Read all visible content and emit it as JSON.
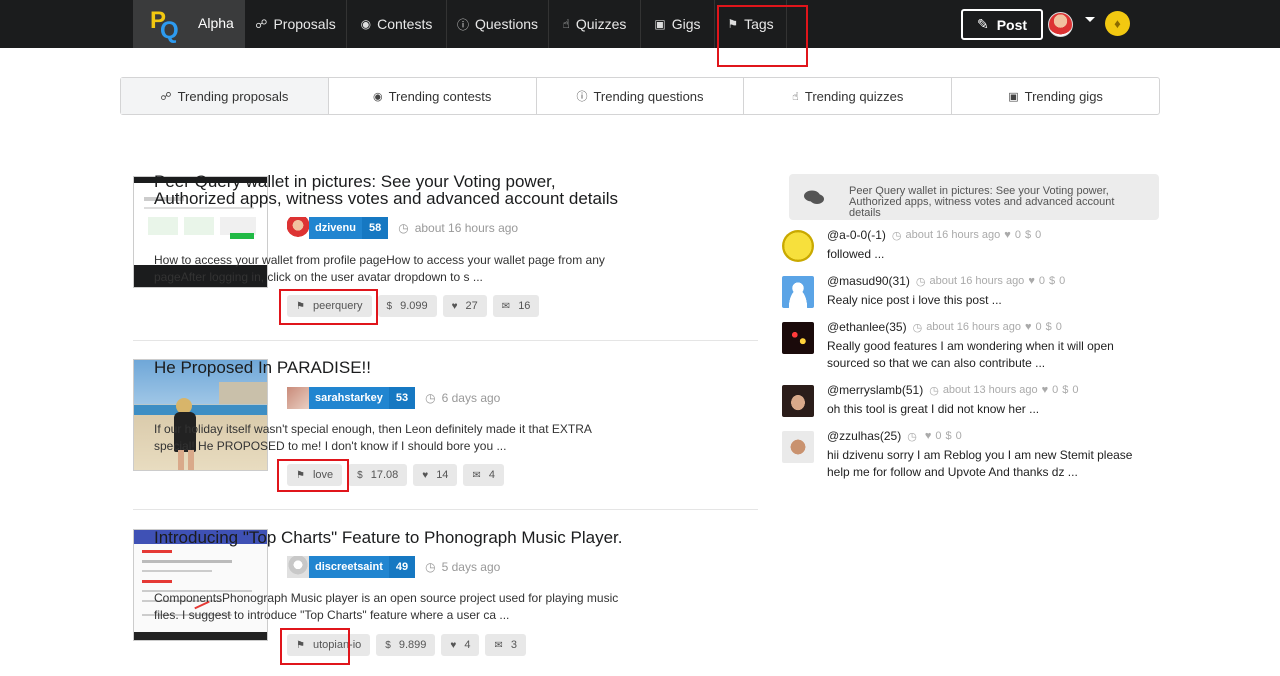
{
  "nav": {
    "brand_label": "Alpha",
    "items": [
      {
        "label": "Proposals",
        "icon": "handshake-icon"
      },
      {
        "label": "Contests",
        "icon": "gamepad-icon"
      },
      {
        "label": "Questions",
        "icon": "question-circle-icon"
      },
      {
        "label": "Quizzes",
        "icon": "hand-pointer-icon"
      },
      {
        "label": "Gigs",
        "icon": "money-bill-icon"
      },
      {
        "label": "Tags",
        "icon": "tag-icon"
      }
    ],
    "post_label": "Post",
    "accent_color": "#f2c811"
  },
  "tabs": [
    {
      "label": "Trending proposals",
      "icon": "handshake-icon",
      "active": true
    },
    {
      "label": "Trending contests",
      "icon": "gamepad-icon"
    },
    {
      "label": "Trending questions",
      "icon": "question-circle-icon"
    },
    {
      "label": "Trending quizzes",
      "icon": "hand-pointer-icon"
    },
    {
      "label": "Trending gigs",
      "icon": "money-bill-icon"
    }
  ],
  "posts": [
    {
      "title": "Peer Query wallet in pictures: See your Voting power, Authorized apps, witness votes and advanced account details",
      "author": "dzivenu",
      "rep": "58",
      "time": "about 16 hours ago",
      "body": "How to access your wallet from profile pageHow to access your wallet page from any pageAfter logging in, click on the user avatar dropdown to s ...",
      "tag": "peerquery",
      "payout": "9.099",
      "likes": "27",
      "comments": "16"
    },
    {
      "title": "He Proposed In PARADISE!!",
      "author": "sarahstarkey",
      "rep": "53",
      "time": "6 days ago",
      "body": "If our holiday itself wasn't special enough, then Leon definitely made it that EXTRA special! He PROPOSED to me! I don't know if I should bore you ...",
      "tag": "love",
      "payout": "17.08",
      "likes": "14",
      "comments": "4"
    },
    {
      "title": "Introducing \"Top Charts\" Feature to Phonograph Music Player.",
      "author": "discreetsaint",
      "rep": "49",
      "time": "5 days ago",
      "body": "ComponentsPhonograph Music player is an open source project used for playing music files. I suggest to introduce \"Top Charts\" feature where a user ca ...",
      "tag": "utopian-io",
      "payout": "9.899",
      "likes": "4",
      "comments": "3"
    }
  ],
  "sidebar": {
    "header": "Peer Query wallet in pictures: See your Voting power, Authorized apps, witness votes and advanced account details",
    "comments": [
      {
        "user": "@a-0-0(-1)",
        "time": "about 16 hours ago",
        "likes": "0",
        "payout": "0",
        "text": "followed ..."
      },
      {
        "user": "@masud90(31)",
        "time": "about 16 hours ago",
        "likes": "0",
        "payout": "0",
        "text": "Realy nice post i love this post ..."
      },
      {
        "user": "@ethanlee(35)",
        "time": "about 16 hours ago",
        "likes": "0",
        "payout": "0",
        "text": "Really good features I am wondering when it will open sourced so that we can also contribute ..."
      },
      {
        "user": "@merryslamb(51)",
        "time": "about 13 hours ago",
        "likes": "0",
        "payout": "0",
        "text": "oh this tool is great I did not know her ..."
      },
      {
        "user": "@zzulhas(25)",
        "time": "",
        "likes": "0",
        "payout": "0",
        "text": "hii dzivenu sorry I am Reblog you I am new Stemit please help me for follow and Upvote And thanks dz ..."
      }
    ]
  }
}
